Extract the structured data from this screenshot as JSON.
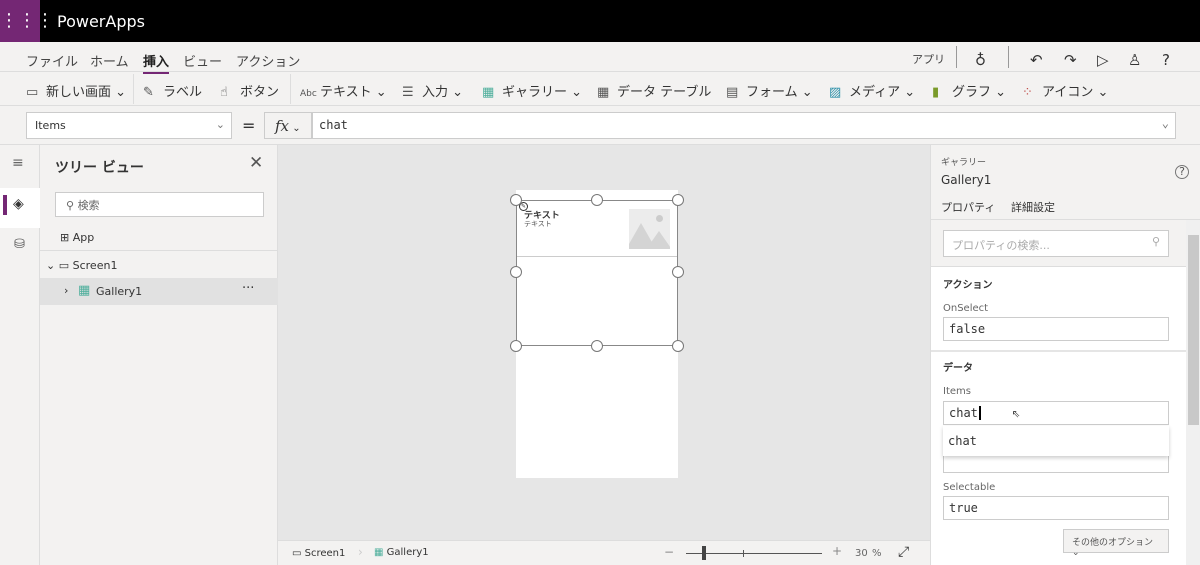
{
  "app": {
    "title": "PowerApps",
    "waffle_icon": "waffle-icon",
    "accent": "#742774"
  },
  "menu": {
    "items": [
      "ファイル",
      "ホーム",
      "挿入",
      "ビュー",
      "アクション"
    ],
    "active": "挿入",
    "right_label": "アプリ"
  },
  "ribbon": {
    "items": [
      {
        "label": "新しい画面",
        "icon": "new-screen-icon",
        "chevron": true
      },
      {
        "label": "ラベル",
        "icon": "label-icon",
        "chevron": false
      },
      {
        "label": "ボタン",
        "icon": "button-icon",
        "chevron": false
      },
      {
        "label": "テキスト",
        "icon": "text-icon",
        "chevron": true
      },
      {
        "label": "入力",
        "icon": "input-icon",
        "chevron": true
      },
      {
        "label": "ギャラリー",
        "icon": "gallery-icon",
        "chevron": true
      },
      {
        "label": "データ テーブル",
        "icon": "data-table-icon",
        "chevron": false
      },
      {
        "label": "フォーム",
        "icon": "form-icon",
        "chevron": true
      },
      {
        "label": "メディア",
        "icon": "media-icon",
        "chevron": true
      },
      {
        "label": "グラフ",
        "icon": "chart-icon",
        "chevron": true
      },
      {
        "label": "アイコン",
        "icon": "icons-icon",
        "chevron": true
      }
    ]
  },
  "formula": {
    "property": "Items",
    "equals": "=",
    "fx": "fx",
    "value": "chat"
  },
  "tree": {
    "title": "ツリー ビュー",
    "search_placeholder": "検索",
    "items": [
      {
        "label": "App"
      },
      {
        "label": "Screen1"
      },
      {
        "label": "Gallery1",
        "selected": true
      }
    ],
    "more": "···"
  },
  "canvas": {
    "title_text": "テキスト",
    "subtitle_text": "テキスト"
  },
  "status": {
    "screen": "Screen1",
    "gallery": "Gallery1",
    "zoom_minus": "−",
    "zoom_plus": "+",
    "zoom_value": "30",
    "zoom_unit": "%",
    "zoom_percent": 30
  },
  "panel": {
    "type": "ギャラリー",
    "name": "Gallery1",
    "tabs": [
      "プロパティ",
      "詳細設定"
    ],
    "active_tab": "詳細設定",
    "search_placeholder": "プロパティの検索...",
    "section_action": "アクション",
    "onselect_label": "OnSelect",
    "onselect_value": "false",
    "section_data": "データ",
    "items_label": "Items",
    "items_value": "chat",
    "suggestion": "chat",
    "selectable_label": "Selectable",
    "selectable_value": "true",
    "more_options": "その他のオプション"
  }
}
